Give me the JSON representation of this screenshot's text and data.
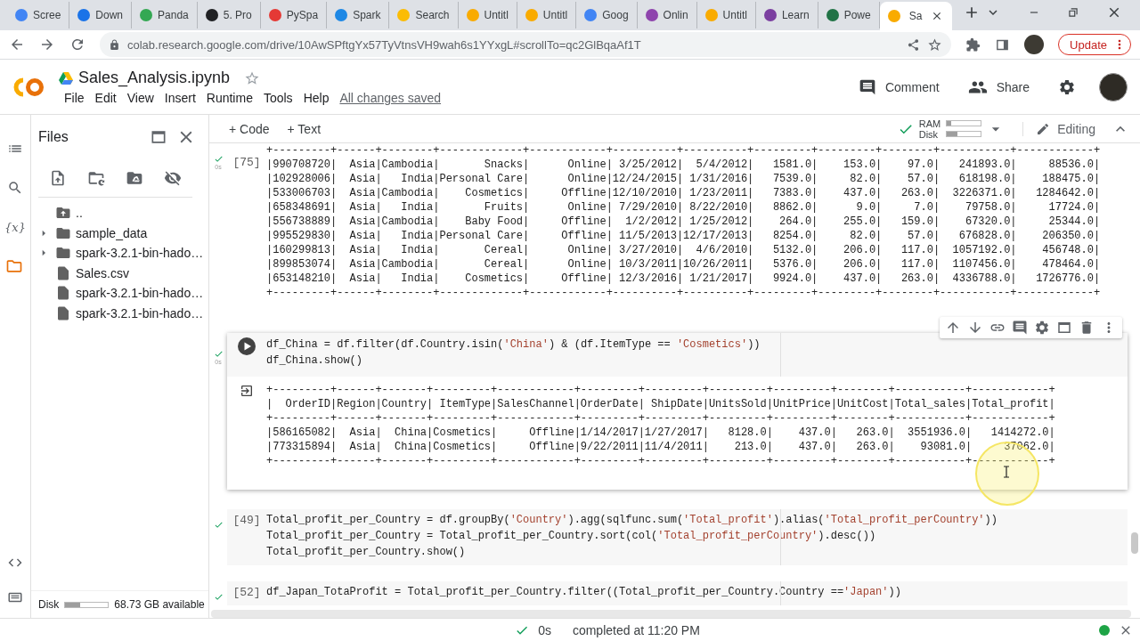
{
  "browser": {
    "tabs": [
      {
        "label": "Scree",
        "color": "#4285f4",
        "selected": false
      },
      {
        "label": "Down",
        "color": "#1a73e8",
        "selected": false
      },
      {
        "label": "Panda",
        "color": "#34a853",
        "selected": false
      },
      {
        "label": "5. Pro",
        "color": "#202124",
        "selected": false
      },
      {
        "label": "PySpa",
        "color": "#e53935",
        "selected": false
      },
      {
        "label": "Spark",
        "color": "#1e88e5",
        "selected": false
      },
      {
        "label": "Search",
        "color": "#fbbc04",
        "selected": false
      },
      {
        "label": "Untitl",
        "color": "#f9ab00",
        "selected": false
      },
      {
        "label": "Untitl",
        "color": "#f9ab00",
        "selected": false
      },
      {
        "label": "Goog",
        "color": "#4285f4",
        "selected": false
      },
      {
        "label": "Onlin",
        "color": "#8e44ad",
        "selected": false
      },
      {
        "label": "Untitl",
        "color": "#f9ab00",
        "selected": false
      },
      {
        "label": "Learn",
        "color": "#7b3fa0",
        "selected": false
      },
      {
        "label": "Powe",
        "color": "#217346",
        "selected": false
      },
      {
        "label": "Sa",
        "color": "#f9ab00",
        "selected": true
      }
    ],
    "url": "colab.research.google.com/drive/10AwSPftgYx57TyVtnsVH9wah6s1YYxgL#scrollTo=qc2GlBqaAf1T",
    "update_button": "Update"
  },
  "notebook": {
    "title": "Sales_Analysis.ipynb",
    "menu": [
      "File",
      "Edit",
      "View",
      "Insert",
      "Runtime",
      "Tools",
      "Help"
    ],
    "save_status": "All changes saved",
    "comment_button": "Comment",
    "share_button": "Share"
  },
  "toolbar": {
    "add_code": "+ Code",
    "add_text": "+ Text",
    "meters": [
      {
        "label": "RAM",
        "level": 0.12
      },
      {
        "label": "Disk",
        "level": 0.3
      }
    ],
    "mode": "Editing"
  },
  "rail": {
    "variables": "{x}"
  },
  "files": {
    "title": "Files",
    "items": [
      {
        "name": "..",
        "kind": "parent"
      },
      {
        "name": "sample_data",
        "kind": "folder",
        "expanded": false
      },
      {
        "name": "spark-3.2.1-bin-hado…",
        "kind": "folder",
        "expanded": false
      },
      {
        "name": "Sales.csv",
        "kind": "file"
      },
      {
        "name": "spark-3.2.1-bin-hado…",
        "kind": "file"
      },
      {
        "name": "spark-3.2.1-bin-hado…",
        "kind": "file"
      }
    ],
    "disk": {
      "label": "Disk",
      "level": 0.35,
      "available": "68.73 GB available"
    }
  },
  "cells": [
    {
      "time": "0s",
      "prompt": {
        "kind": "count",
        "text": "[75]"
      },
      "focused": false,
      "output": [
        "+---------+------+--------+-------------+------------+----------+----------+---------+---------+--------+-----------+------------+",
        "|990708720|  Asia|Cambodia|       Snacks|      Online| 3/25/2012|  5/4/2012|   1581.0|    153.0|    97.0|   241893.0|     88536.0|",
        "|102928006|  Asia|   India|Personal Care|      Online|12/24/2015| 1/31/2016|   7539.0|     82.0|    57.0|   618198.0|    188475.0|",
        "|533006703|  Asia|Cambodia|    Cosmetics|     Offline|12/10/2010| 1/23/2011|   7383.0|    437.0|   263.0|  3226371.0|   1284642.0|",
        "|658348691|  Asia|   India|       Fruits|      Online| 7/29/2010| 8/22/2010|   8862.0|      9.0|     7.0|    79758.0|     17724.0|",
        "|556738889|  Asia|Cambodia|    Baby Food|     Offline|  1/2/2012| 1/25/2012|    264.0|    255.0|   159.0|    67320.0|     25344.0|",
        "|995529830|  Asia|   India|Personal Care|     Offline| 11/5/2013|12/17/2013|   8254.0|     82.0|    57.0|   676828.0|    206350.0|",
        "|160299813|  Asia|   India|       Cereal|      Online| 3/27/2010|  4/6/2010|   5132.0|    206.0|   117.0|  1057192.0|    456748.0|",
        "|899853074|  Asia|Cambodia|       Cereal|      Online| 10/3/2011|10/26/2011|   5376.0|    206.0|   117.0|  1107456.0|    478464.0|",
        "|653148210|  Asia|   India|    Cosmetics|     Offline| 12/3/2016| 1/21/2017|   9924.0|    437.0|   263.0|  4336788.0|   1726776.0|",
        "+---------+------+--------+-------------+------------+----------+----------+---------+---------+--------+-----------+------------+"
      ]
    },
    {
      "time": "0s",
      "prompt": {
        "kind": "run"
      },
      "focused": true,
      "code": [
        [
          {
            "text": "df_China = df.filter(df.Country.isin(",
            "kind": "plain"
          },
          {
            "text": "'China'",
            "kind": "string"
          },
          {
            "text": ") & (df.ItemType == ",
            "kind": "plain"
          },
          {
            "text": "'Cosmetics'",
            "kind": "string"
          },
          {
            "text": "))",
            "kind": "plain"
          }
        ],
        [
          {
            "text": "df_China.show()",
            "kind": "plain"
          }
        ]
      ],
      "output": [
        "+---------+------+-------+---------+------------+---------+---------+---------+---------+--------+-----------+------------+",
        "|  OrderID|Region|Country| ItemType|SalesChannel|OrderDate| ShipDate|UnitsSold|UnitPrice|UnitCost|Total_sales|Total_profit|",
        "+---------+------+-------+---------+------------+---------+---------+---------+---------+--------+-----------+------------+",
        "|586165082|  Asia|  China|Cosmetics|     Offline|1/14/2017|1/27/2017|   8128.0|    437.0|   263.0|  3551936.0|   1414272.0|",
        "|773315894|  Asia|  China|Cosmetics|     Offline|9/22/2011|11/4/2011|    213.0|    437.0|   263.0|    93081.0|     37062.0|",
        "+---------+------+-------+---------+------------+---------+---------+---------+---------+--------+-----------+------------+"
      ]
    },
    {
      "prompt": {
        "kind": "count",
        "text": "[49]"
      },
      "focused": false,
      "code": [
        [
          {
            "text": "Total_profit_per_Country = df.groupBy(",
            "kind": "plain"
          },
          {
            "text": "'Country'",
            "kind": "string"
          },
          {
            "text": ").agg(sqlfunc.sum(",
            "kind": "plain"
          },
          {
            "text": "'Total_profit'",
            "kind": "string"
          },
          {
            "text": ").alias(",
            "kind": "plain"
          },
          {
            "text": "'Total_profit_perCountry'",
            "kind": "string"
          },
          {
            "text": "))",
            "kind": "plain"
          }
        ],
        [
          {
            "text": "Total_profit_per_Country = Total_profit_per_Country.sort(col(",
            "kind": "plain"
          },
          {
            "text": "'Total_profit_perCountry'",
            "kind": "string"
          },
          {
            "text": ").desc())",
            "kind": "plain"
          }
        ],
        [
          {
            "text": "Total_profit_per_Country.show()",
            "kind": "plain"
          }
        ]
      ]
    },
    {
      "prompt": {
        "kind": "count",
        "text": "[52]"
      },
      "focused": false,
      "code": [
        [
          {
            "text": "df_Japan_TotaProfit = Total_profit_per_Country.filter((Total_profit_per_Country.Country ==",
            "kind": "plain"
          },
          {
            "text": "'Japan'",
            "kind": "string"
          },
          {
            "text": "))",
            "kind": "plain"
          }
        ]
      ]
    }
  ],
  "status_bar": {
    "duration": "0s",
    "message": "completed at 11:20 PM"
  }
}
